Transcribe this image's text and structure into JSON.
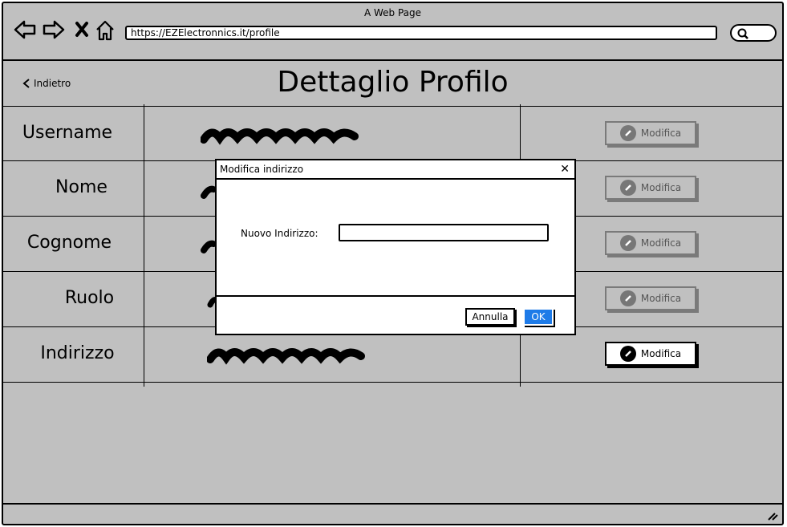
{
  "window": {
    "title": "A Web Page",
    "url": "https://EZElectronnics.it/profile"
  },
  "page": {
    "back_label": "Indietro",
    "title": "Dettaglio Profilo"
  },
  "profile_rows": [
    {
      "label": "Username",
      "edit_label": "Modifica",
      "enabled": false
    },
    {
      "label": "Nome",
      "edit_label": "Modifica",
      "enabled": false
    },
    {
      "label": "Cognome",
      "edit_label": "Modifica",
      "enabled": false
    },
    {
      "label": "Ruolo",
      "edit_label": "Modifica",
      "enabled": false
    },
    {
      "label": "Indirizzo",
      "edit_label": "Modifica",
      "enabled": true
    }
  ],
  "dialog": {
    "title": "Modifica indirizzo",
    "close_icon": "close-icon",
    "field_label": "Nuovo Indirizzo:",
    "field_value": "",
    "cancel_label": "Annulla",
    "ok_label": "OK"
  },
  "colors": {
    "background": "#c0c0c0",
    "accent": "#1e7be8"
  }
}
